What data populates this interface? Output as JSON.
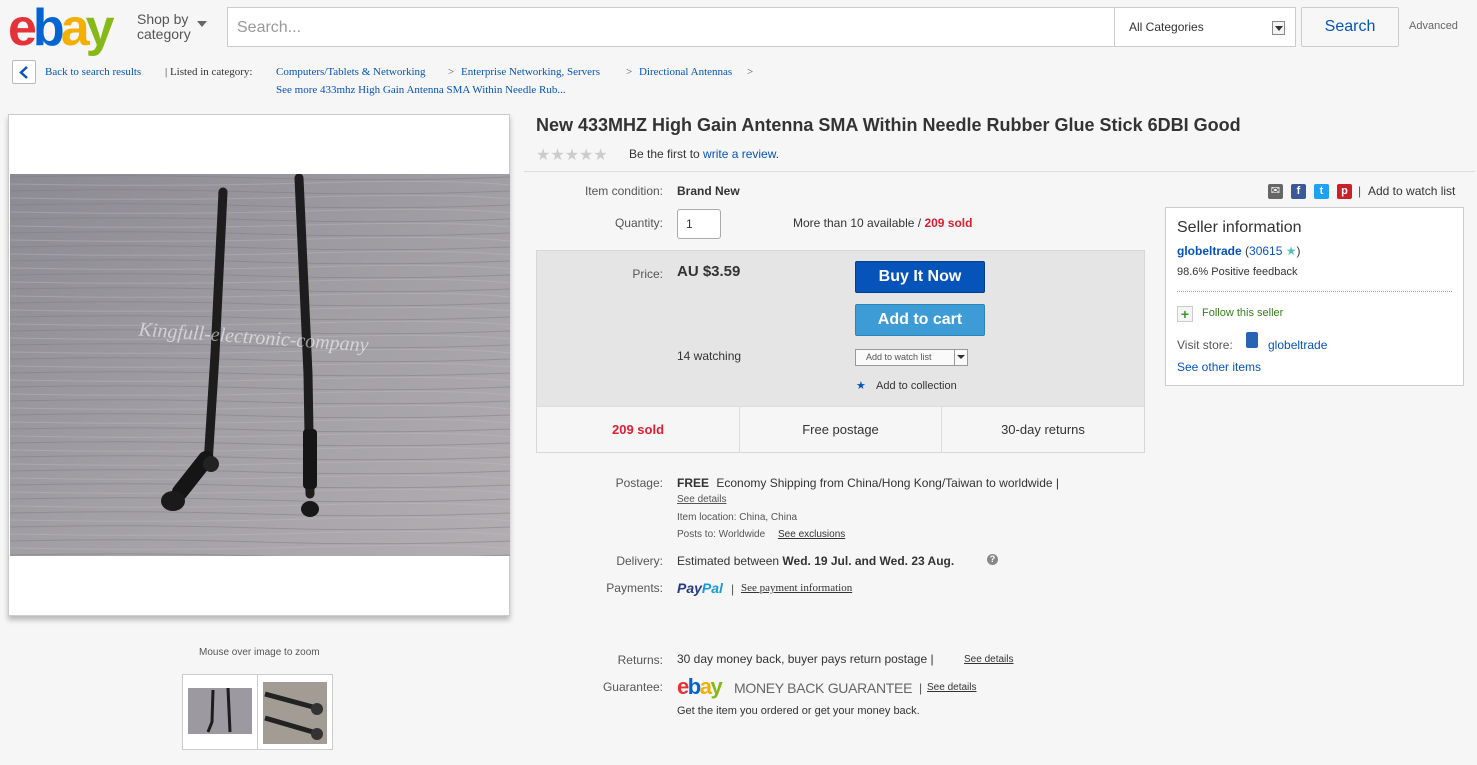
{
  "header": {
    "logo_letters": [
      "e",
      "b",
      "a",
      "y"
    ],
    "logo_colors": [
      "#e53238",
      "#0064d2",
      "#f5af02",
      "#86b817"
    ],
    "shop_by_line1": "Shop by",
    "shop_by_line2": "category",
    "search_placeholder": "Search...",
    "category_value": "All Categories",
    "search_button": "Search",
    "advanced": "Advanced"
  },
  "breadcrumb": {
    "back": "Back to search results",
    "listed_in": "| Listed in category:",
    "items": [
      "Computers/Tablets & Networking",
      "Enterprise Networking, Servers",
      "Directional Antennas"
    ],
    "separator": ">",
    "see_more": "See more 433mhz High Gain Antenna SMA Within Needle Rub..."
  },
  "gallery": {
    "watermark": "Kingfull-electronic-company",
    "zoom_hint": "Mouse over image to zoom"
  },
  "item": {
    "title": "New 433MHZ High Gain Antenna SMA Within Needle Rubber Glue Stick 6DBI Good",
    "stars": "★★★★★",
    "review_prefix": "Be the first to",
    "review_link": "write a review",
    "review_suffix": ".",
    "condition_label": "Item condition:",
    "condition_value": "Brand New",
    "quantity_label": "Quantity:",
    "quantity_value": "1",
    "availability": "More than 10 available /",
    "sold_count": "209 sold",
    "price_label": "Price:",
    "price_value": "AU $3.59",
    "buy_now": "Buy It Now",
    "add_to_cart": "Add to cart",
    "watching": "14 watching",
    "add_to_watch_dropdown": "Add to watch list",
    "add_to_collection": "Add to collection",
    "strip": [
      "209 sold",
      "Free postage",
      "30-day returns"
    ]
  },
  "share": {
    "add_to_watch_list": "Add to watch list",
    "divider": "|"
  },
  "seller": {
    "heading": "Seller information",
    "name": "globeltrade",
    "feedback_count": "30615",
    "positive": "98.6% Positive feedback",
    "follow": "Follow this seller",
    "visit_store_label": "Visit store:",
    "store_name": "globeltrade",
    "other_items": "See other items"
  },
  "postage": {
    "label": "Postage:",
    "free": "FREE",
    "desc": "Economy Shipping from China/Hong Kong/Taiwan to worldwide |",
    "see_details": "See details",
    "item_location": "Item location:  China, China",
    "posts_to_label": "Posts to:  Worldwide",
    "see_exclusions": "See exclusions"
  },
  "delivery": {
    "label": "Delivery:",
    "prefix": "Estimated between",
    "dates": "Wed. 19 Jul. and Wed. 23 Aug."
  },
  "payments": {
    "label": "Payments:",
    "paypal_pay": "Pay",
    "paypal_pal": "Pal",
    "divider": "|",
    "link": "See payment information"
  },
  "returns": {
    "label": "Returns:",
    "text": "30 day money back, buyer pays return postage |",
    "link": "See details"
  },
  "guarantee": {
    "label": "Guarantee:",
    "mbg": "MONEY BACK GUARANTEE",
    "divider": "|",
    "link": "See details",
    "text": "Get the item you ordered or get your money back."
  }
}
